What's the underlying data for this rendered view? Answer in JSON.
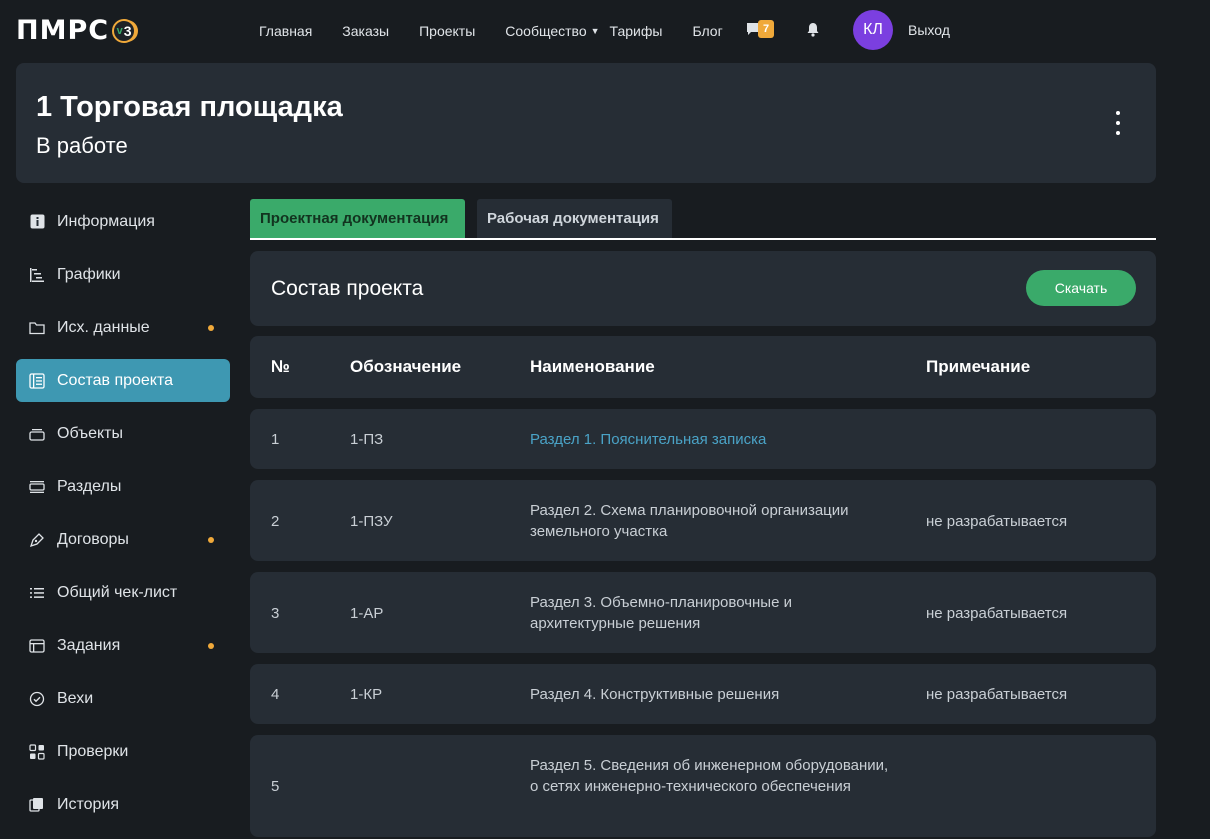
{
  "nav": {
    "logo": "ПМРС",
    "version": "3",
    "version_prefix": "v",
    "items": [
      "Главная",
      "Заказы",
      "Проекты",
      "Сообщество",
      "Тарифы",
      "Блог"
    ],
    "messages_count": "7",
    "avatar_initials": "КЛ",
    "logout": "Выход"
  },
  "header": {
    "title": "1 Торговая площадка",
    "status": "В работе"
  },
  "sidebar": {
    "items": [
      {
        "label": "Информация",
        "icon": "info-icon",
        "dot": false
      },
      {
        "label": "Графики",
        "icon": "gantt-icon",
        "dot": false
      },
      {
        "label": "Исх. данные",
        "icon": "folder-icon",
        "dot": true
      },
      {
        "label": "Состав проекта",
        "icon": "document-list-icon",
        "dot": false,
        "active": true
      },
      {
        "label": "Объекты",
        "icon": "layers-icon",
        "dot": false
      },
      {
        "label": "Разделы",
        "icon": "sections-icon",
        "dot": false
      },
      {
        "label": "Договоры",
        "icon": "pen-icon",
        "dot": true
      },
      {
        "label": "Общий чек-лист",
        "icon": "checklist-icon",
        "dot": false
      },
      {
        "label": "Задания",
        "icon": "tasks-icon",
        "dot": true
      },
      {
        "label": "Вехи",
        "icon": "check-circle-icon",
        "dot": false
      },
      {
        "label": "Проверки",
        "icon": "grid-check-icon",
        "dot": false
      },
      {
        "label": "История",
        "icon": "history-icon",
        "dot": false
      }
    ]
  },
  "tabs": [
    {
      "label": "Проектная документация",
      "active": true
    },
    {
      "label": "Рабочая документация",
      "active": false
    }
  ],
  "section": {
    "title": "Состав проекта",
    "download": "Скачать"
  },
  "table": {
    "headers": {
      "num": "№",
      "code": "Обозначение",
      "name": "Наименование",
      "note": "Примечание"
    },
    "rows": [
      {
        "num": "1",
        "code": "1-ПЗ",
        "name": "Раздел 1. Пояснительная записка",
        "note": ""
      },
      {
        "num": "2",
        "code": "1-ПЗУ",
        "name": "Раздел 2. Схема планировочной организации земельного участка",
        "note": "не разрабатывается"
      },
      {
        "num": "3",
        "code": "1-АР",
        "name": "Раздел 3. Объемно-планировочные и архитектурные решения",
        "note": "не разрабатывается"
      },
      {
        "num": "4",
        "code": "1-КР",
        "name": "Раздел 4. Конструктивные решения",
        "note": "не разрабатывается"
      },
      {
        "num": "5",
        "code": "",
        "name": "Раздел 5. Сведения об инженерном оборудовании, о сетях инженерно-технического обеспечения",
        "note": ""
      }
    ]
  },
  "colors": {
    "accent_green": "#3aaa6a",
    "active_blue": "#3e98b2",
    "link_blue": "#4aa3c7",
    "badge_orange": "#f0a93a",
    "avatar_purple": "#7b3fe0"
  }
}
